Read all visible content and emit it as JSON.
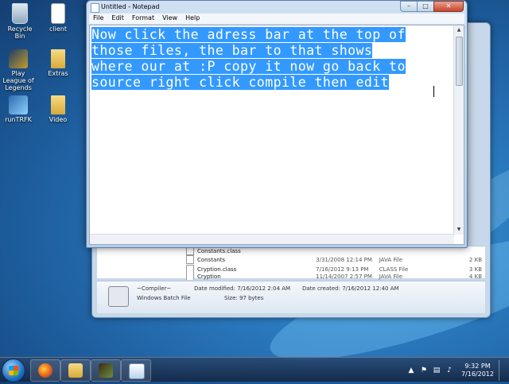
{
  "desktop": {
    "icons": [
      {
        "label": "Recycle Bin",
        "icon": "recycle-bin-icon"
      },
      {
        "label": "client",
        "icon": "document-icon"
      },
      {
        "label": "Play League of Legends",
        "icon": "league-icon"
      },
      {
        "label": "Extras",
        "icon": "folder-icon"
      },
      {
        "label": "runTRFK",
        "icon": "tool-icon"
      },
      {
        "label": "Video",
        "icon": "folder-icon"
      }
    ]
  },
  "notepad": {
    "title": "Untitled - Notepad",
    "menu": [
      "File",
      "Edit",
      "Format",
      "View",
      "Help"
    ],
    "window_buttons": {
      "minimize": "–",
      "maximize": "□",
      "close": "✕"
    },
    "text_lines": [
      "Now click the adress bar at the top of",
      "those files, the bar to that shows",
      "where our at :P copy it now go back to",
      "source right click compile then edit"
    ]
  },
  "explorer": {
    "files": [
      {
        "name": "Constants.class",
        "date": "",
        "type": "",
        "size": ""
      },
      {
        "name": "Constants",
        "date": "3/31/2008 12:14 PM",
        "type": "JAVA File",
        "size": "2 KB"
      },
      {
        "name": "Cryption.class",
        "date": "7/16/2012 9:13 PM",
        "type": "CLASS File",
        "size": "3 KB"
      },
      {
        "name": "Cryption",
        "date": "11/14/2007 2:57 PM",
        "type": "JAVA File",
        "size": "4 KB"
      }
    ],
    "details": {
      "name": "~Compiler~",
      "type": "Windows Batch File",
      "modified": "Date modified: 7/16/2012 2:04 AM",
      "size": "Size: 97 bytes",
      "created": "Date created: 7/16/2012 12:40 AM"
    }
  },
  "taskbar": {
    "buttons": [
      "firefox-icon",
      "folder-icon",
      "minecraft-icon",
      "notepad-icon"
    ],
    "clock_time": "9:32 PM",
    "clock_date": "7/16/2012"
  }
}
